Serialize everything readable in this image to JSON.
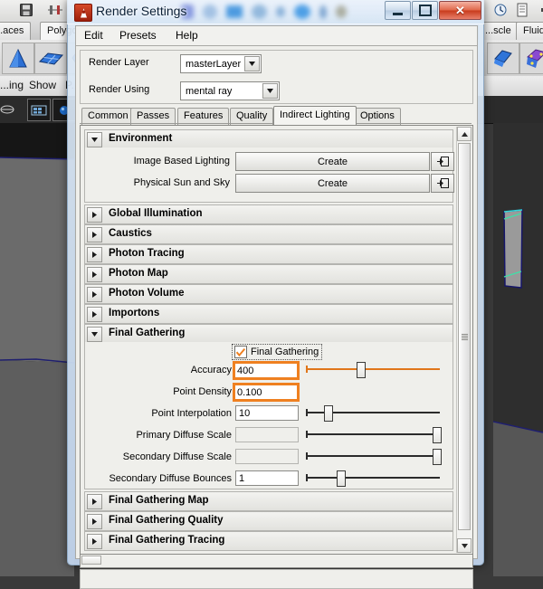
{
  "background_app": {
    "shelf_tabs": [
      "...aces",
      "Polygons"
    ],
    "shelf_tabs_right": [
      "...scle",
      "Fluids"
    ],
    "menus": [
      "...ing",
      "Show",
      "P..."
    ],
    "icons": [
      "save-icon",
      "slider-icon",
      "snap-icon",
      "history-icon",
      "document-icon",
      "clapper-icon",
      "film-icon",
      "sphere-icon",
      "disk-icon"
    ]
  },
  "window": {
    "title": "Render Settings",
    "icon": "maya-render-icon",
    "buttons": {
      "minimize": "–",
      "maximize": "❐",
      "close": "✕"
    },
    "menubar": [
      "Edit",
      "Presets",
      "Help"
    ]
  },
  "top_fields": [
    {
      "label": "Render Layer",
      "value": "masterLayer"
    },
    {
      "label": "Render Using",
      "value": "mental ray"
    }
  ],
  "tabs": [
    {
      "label": "Common",
      "active": false
    },
    {
      "label": "Passes",
      "active": false
    },
    {
      "label": "Features",
      "active": false
    },
    {
      "label": "Quality",
      "active": false
    },
    {
      "label": "Indirect Lighting",
      "active": true
    },
    {
      "label": "Options",
      "active": false
    }
  ],
  "sections": {
    "environment": {
      "title": "Environment",
      "expanded": true,
      "rows": [
        {
          "label": "Image Based Lighting",
          "button": "Create",
          "map_icon": "map-arrow-icon"
        },
        {
          "label": "Physical Sun and Sky",
          "button": "Create",
          "map_icon": "map-arrow-icon"
        }
      ]
    },
    "collapsed_before": [
      "Global Illumination",
      "Caustics",
      "Photon Tracing",
      "Photon Map",
      "Photon Volume",
      "Importons"
    ],
    "final_gathering": {
      "title": "Final Gathering",
      "expanded": true,
      "checkbox": {
        "label": "Final Gathering",
        "checked": true
      },
      "rows": [
        {
          "label": "Accuracy",
          "value": "400",
          "highlighted": true,
          "slider": {
            "pos": 40,
            "accent": "#e0761a"
          }
        },
        {
          "label": "Point Density",
          "value": "0.100",
          "highlighted": true,
          "slider": null
        },
        {
          "label": "Point Interpolation",
          "value": "10",
          "highlighted": false,
          "slider": {
            "pos": 15,
            "accent": "#2b2b2b"
          }
        },
        {
          "label": "Primary Diffuse Scale",
          "value": "",
          "highlighted": false,
          "slider": {
            "pos": 100,
            "accent": "#2b2b2b"
          }
        },
        {
          "label": "Secondary Diffuse Scale",
          "value": "",
          "highlighted": false,
          "slider": {
            "pos": 100,
            "accent": "#2b2b2b"
          }
        },
        {
          "label": "Secondary Diffuse Bounces",
          "value": "1",
          "highlighted": false,
          "slider": {
            "pos": 25,
            "accent": "#2b2b2b"
          }
        }
      ]
    },
    "collapsed_after": [
      "Final Gathering Map",
      "Final Gathering Quality",
      "Final Gathering Tracing"
    ]
  },
  "colors": {
    "highlight_orange": "#ef8020",
    "slider_orange": "#e0761a",
    "panel_gray": "#efefeb",
    "aero_blue": "#cddef1"
  },
  "glyphs": {
    "arrow_expanded": "▼",
    "arrow_collapsed": "▶",
    "combo_arrow": "▼",
    "scroll_up": "▲",
    "scroll_down": "▼",
    "check": "✔"
  }
}
